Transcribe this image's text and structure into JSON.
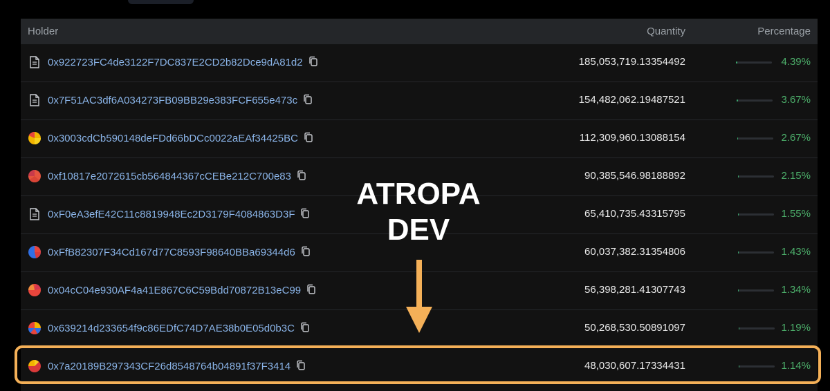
{
  "table": {
    "headers": {
      "holder": "Holder",
      "quantity": "Quantity",
      "percentage": "Percentage"
    },
    "accent_color": "#4cae6a",
    "address_color": "#8ab4e8",
    "rows": [
      {
        "icon": "document-icon",
        "address": "0x922723FC4de3122F7DC837E2CD2b82Dce9dA81d2",
        "quantity": "185,053,719.13354492",
        "percentage": "4.39%",
        "share": 4.39
      },
      {
        "icon": "document-icon",
        "address": "0x7F51AC3df6A034273FB09BB29e383FCF655e473c",
        "quantity": "154,482,062.19487521",
        "percentage": "3.67%",
        "share": 3.67
      },
      {
        "icon": "avatar-icon",
        "address": "0x3003cdCb590148deFDd66bDCc0022aEAf34425BC",
        "quantity": "112,309,960.13088154",
        "percentage": "2.67%",
        "share": 2.67
      },
      {
        "icon": "avatar-icon",
        "address": "0xf10817e2072615cb564844367cCEBe212C700e83",
        "quantity": "90,385,546.98188892",
        "percentage": "2.15%",
        "share": 2.15
      },
      {
        "icon": "document-icon",
        "address": "0xF0eA3efE42C11c8819948Ec2D3179F4084863D3F",
        "quantity": "65,410,735.43315795",
        "percentage": "1.55%",
        "share": 1.55
      },
      {
        "icon": "avatar-icon",
        "address": "0xFfB82307F34Cd167d77C8593F98640BBa69344d6",
        "quantity": "60,037,382.31354806",
        "percentage": "1.43%",
        "share": 1.43
      },
      {
        "icon": "avatar-icon",
        "address": "0x04cC04e930AF4a41E867C6C59Bdd70872B13eC99",
        "quantity": "56,398,281.41307743",
        "percentage": "1.34%",
        "share": 1.34
      },
      {
        "icon": "avatar-icon",
        "address": "0x639214d233654f9c86EDfC74D7AE38b0E05d0b3C",
        "quantity": "50,268,530.50891097",
        "percentage": "1.19%",
        "share": 1.19
      },
      {
        "icon": "avatar-icon",
        "address": "0x7a20189B297343CF26d8548764b04891f37F3414",
        "quantity": "48,030,607.17334431",
        "percentage": "1.14%",
        "share": 1.14
      }
    ]
  },
  "annotation": {
    "line1": "ATROPA",
    "line2": "DEV",
    "color": "#f4b058"
  }
}
